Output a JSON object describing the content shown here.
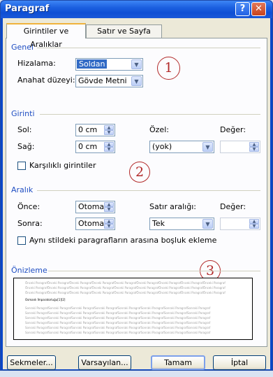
{
  "window": {
    "title": "Paragraf",
    "help_glyph": "?",
    "close_glyph": "✕"
  },
  "tabs": [
    {
      "label": "Girintiler ve Aralıklar",
      "active": true
    },
    {
      "label": "Satır ve Sayfa Sonu",
      "active": false
    }
  ],
  "genel": {
    "section_title": "Genel",
    "hizalama": {
      "label": "Hizalama:",
      "value": "Soldan"
    },
    "anahat": {
      "label": "Anahat düzeyi:",
      "value": "Gövde Metni"
    }
  },
  "girinti": {
    "section_title": "Girinti",
    "sol": {
      "label": "Sol:",
      "value": "0 cm"
    },
    "sag": {
      "label": "Sağ:",
      "value": "0 cm"
    },
    "ozel": {
      "label": "Özel:",
      "value": "(yok)"
    },
    "deger": {
      "label": "Değer:",
      "value": ""
    },
    "karsilikli": {
      "label": "Karşılıklı girintiler",
      "checked": false
    }
  },
  "aralik": {
    "section_title": "Aralık",
    "once": {
      "label": "Önce:",
      "value": "Otomatik"
    },
    "sonra": {
      "label": "Sonra:",
      "value": "Otomatik"
    },
    "satir_araligi": {
      "label": "Satır aralığı:",
      "value": "Tek"
    },
    "deger": {
      "label": "Değer:",
      "value": ""
    },
    "ayni_stil": {
      "label": "Aynı stildeki paragrafların arasına boşluk ekleme",
      "checked": false
    }
  },
  "onizleme": {
    "section_title": "Önizleme",
    "prev_text": "Önceki ParagrafÖnceki ParagrafÖnceki ParagrafÖnceki ParagrafÖnceki ParagrafÖnceki ParagrafÖnceki ParagrafÖnceki ParagrafÖnceki Paragraf",
    "main_text": "Osmanlı İmparatorluğu[1][2]",
    "next_text": "Sonraki ParagrafSonraki ParagrafSonraki ParagrafSonraki ParagrafSonraki ParagrafSonraki ParagrafSonraki ParagrafSonraki Paragraf"
  },
  "buttons": {
    "sekmeler": "Sekmeler...",
    "varsayilan": "Varsayılan...",
    "tamam": "Tamam",
    "iptal": "İptal"
  },
  "annotations": [
    "1",
    "2",
    "3"
  ],
  "colors": {
    "title_bar": "#0f4fd4",
    "section_title": "#1f4ec2",
    "annotation": "#b22a2a",
    "selection": "#316ac5"
  }
}
